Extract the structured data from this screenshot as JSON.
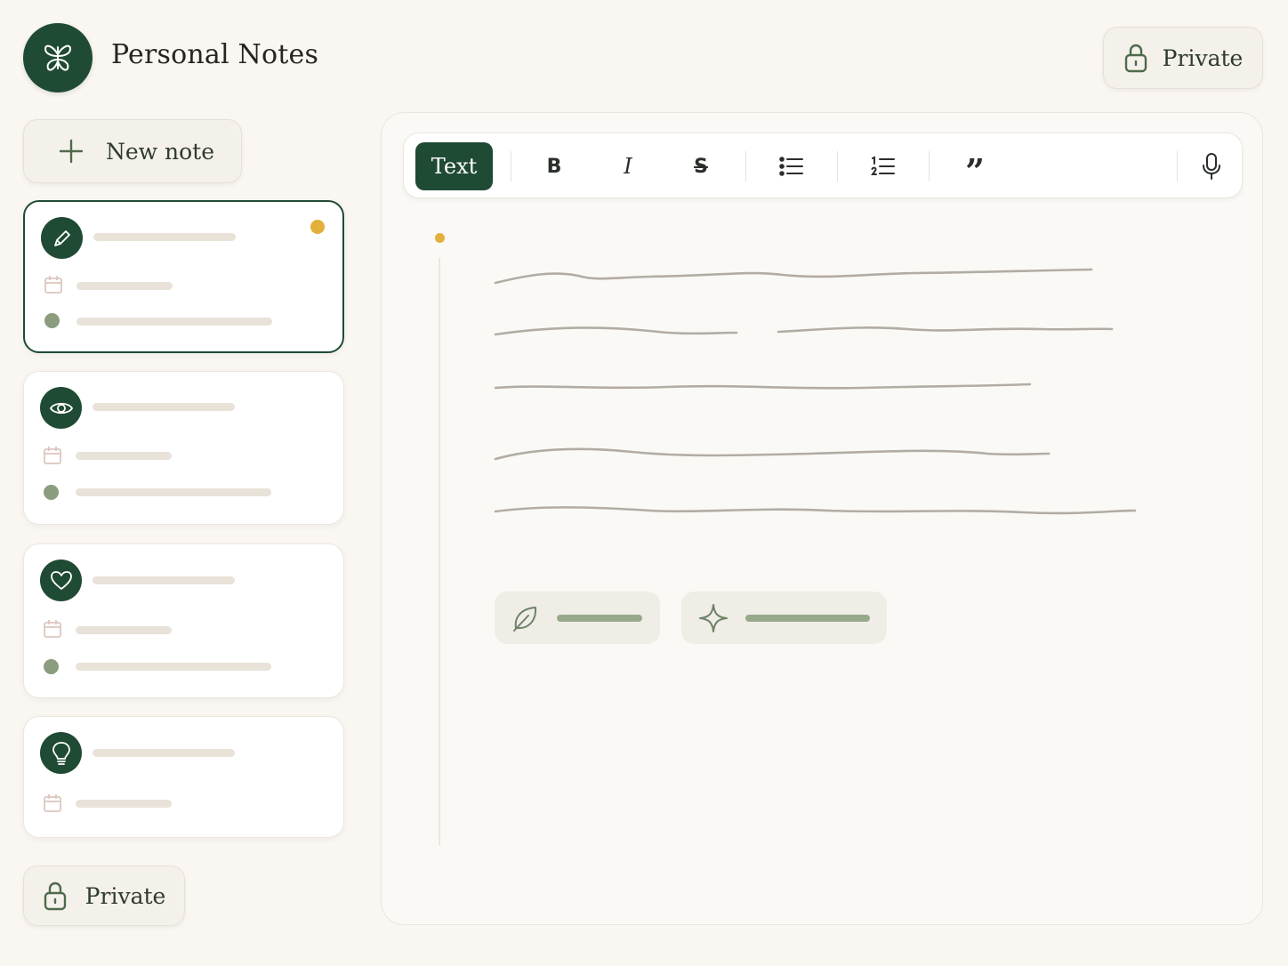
{
  "header": {
    "title": "Personal Notes",
    "logo_icon": "butterfly-icon",
    "privacy_label": "Private",
    "privacy_icon": "lock-icon"
  },
  "sidebar": {
    "new_note_label": "New note",
    "new_note_icon": "plus-icon",
    "notes": [
      {
        "icon": "pencil-icon",
        "active": true,
        "unread": true,
        "has_tag": true
      },
      {
        "icon": "eye-icon",
        "active": false,
        "unread": false,
        "has_tag": true
      },
      {
        "icon": "heart-icon",
        "active": false,
        "unread": false,
        "has_tag": true
      },
      {
        "icon": "lightbulb-icon",
        "active": false,
        "unread": false,
        "has_tag": false
      }
    ],
    "privacy_label": "Private"
  },
  "editor": {
    "toolbar": {
      "text_label": "Text",
      "buttons": [
        "bold-icon",
        "italic-icon",
        "strikethrough-icon",
        "bullet-list-icon",
        "numbered-list-icon",
        "quote-icon",
        "microphone-icon"
      ]
    },
    "chips": [
      {
        "icon": "leaf-icon"
      },
      {
        "icon": "sparkle-icon"
      }
    ]
  },
  "colors": {
    "brand": "#1f4a34",
    "accent_dot": "#e3b03c",
    "background": "#faf7f3",
    "sage": "#8b9c7f"
  }
}
